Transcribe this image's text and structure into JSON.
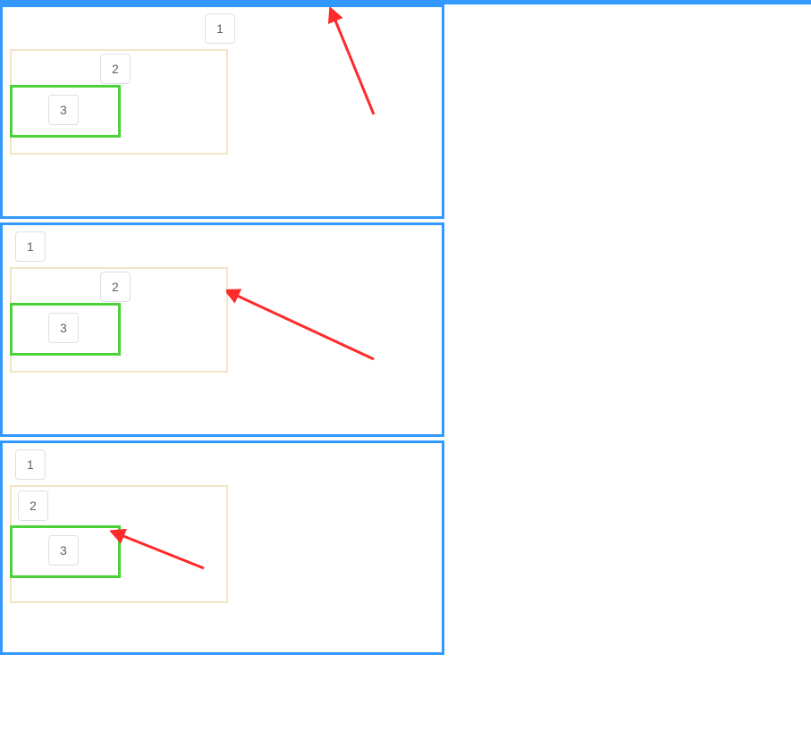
{
  "panels": [
    {
      "button1": {
        "label": "1"
      },
      "button2": {
        "label": "2"
      },
      "button3": {
        "label": "3"
      },
      "layout": {
        "button1_position": "inline-right",
        "button2_position": "inline-right",
        "arrow_points_to": "panel-border"
      }
    },
    {
      "button1": {
        "label": "1"
      },
      "button2": {
        "label": "2"
      },
      "button3": {
        "label": "3"
      },
      "layout": {
        "button1_position": "top-left",
        "button2_position": "inline-right",
        "arrow_points_to": "box-2"
      }
    },
    {
      "button1": {
        "label": "1"
      },
      "button2": {
        "label": "2"
      },
      "button3": {
        "label": "3"
      },
      "layout": {
        "button1_position": "top-left",
        "button2_position": "top-left",
        "arrow_points_to": "box-3"
      }
    }
  ],
  "diagram_description": "Three stacked panels demonstrating nested box placement variations with numbered buttons and red pointer arrows indicating focus targets."
}
